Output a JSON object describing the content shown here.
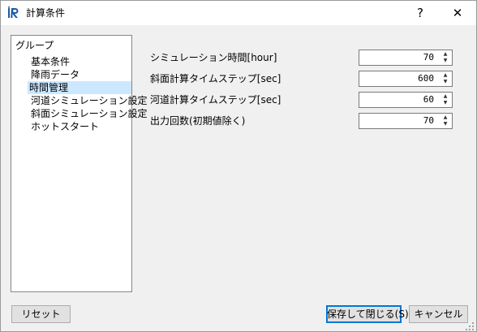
{
  "window": {
    "title": "計算条件",
    "help_label": "?",
    "close_label": "✕",
    "app_icon": "iric-app-icon"
  },
  "group": {
    "header": "グループ",
    "items": [
      {
        "label": "基本条件",
        "selected": false
      },
      {
        "label": "降雨データ",
        "selected": false
      },
      {
        "label": "時間管理",
        "selected": true
      },
      {
        "label": "河道シミュレーション設定",
        "selected": false
      },
      {
        "label": "斜面シミュレーション設定",
        "selected": false
      },
      {
        "label": "ホットスタート",
        "selected": false
      }
    ]
  },
  "fields": [
    {
      "label": "シミュレーション時間[hour]",
      "value": "70"
    },
    {
      "label": "斜面計算タイムステップ[sec]",
      "value": "600"
    },
    {
      "label": "河道計算タイムステップ[sec]",
      "value": "60"
    },
    {
      "label": "出力回数(初期値除く)",
      "value": "70"
    }
  ],
  "buttons": {
    "reset": "リセット",
    "save_close": "保存して閉じる(S)",
    "cancel": "キャンセル"
  },
  "colors": {
    "selection": "#cce8ff",
    "default_button_border": "#0078d7",
    "icon_blue": "#1e5aa8"
  }
}
